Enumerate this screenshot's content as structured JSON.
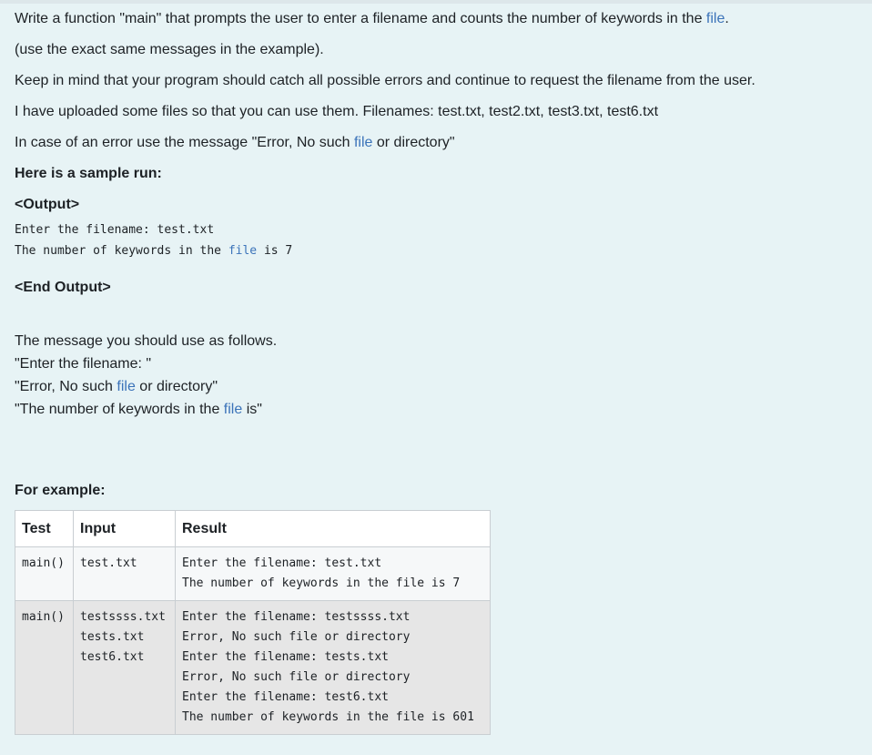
{
  "intro": {
    "line1_before": "Write a function \"main\" that prompts the user to enter a filename and counts the number of keywords in the ",
    "line1_kw": "file",
    "line1_after": ".",
    "line2": "(use the exact same messages in the example).",
    "line3": "Keep in mind that your program should catch all possible errors and continue to request the filename from the user.",
    "line4": "I have uploaded some files so that you can use them. Filenames: test.txt, test2.txt, test3.txt, test6.txt",
    "line5_before": "In case of an error use the message \"Error, No such ",
    "line5_kw": "file",
    "line5_after": " or directory\""
  },
  "sample": {
    "heading": "Here is a sample run:",
    "output_open": "<Output>",
    "out_line1": "Enter the filename: test.txt",
    "out_line2_before": "The number of keywords in the ",
    "out_line2_kw": "file",
    "out_line2_after": " is 7",
    "output_close": "<End Output>"
  },
  "messages": {
    "intro": "The message you should use as follows.",
    "m1": "\"Enter the filename: \"",
    "m2_before": "\"Error, No such ",
    "m2_kw": "file",
    "m2_after": " or directory\"",
    "m3_before": "\"The number of keywords in the ",
    "m3_kw": "file",
    "m3_after": " is\""
  },
  "examples": {
    "heading": "For example:",
    "columns": [
      "Test",
      "Input",
      "Result"
    ],
    "rows": [
      {
        "test": "main()",
        "input": "test.txt",
        "result": "Enter the filename: test.txt\nThe number of keywords in the file is 7"
      },
      {
        "test": "main()",
        "input": "testssss.txt\ntests.txt\ntest6.txt",
        "result": "Enter the filename: testssss.txt\nError, No such file or directory\nEnter the filename: tests.txt\nError, No such file or directory\nEnter the filename: test6.txt\nThe number of keywords in the file is 601"
      }
    ]
  },
  "colors": {
    "background": "#e7f3f5",
    "keyword_link": "#3b73b9",
    "table_header_bg": "#ffffff",
    "row1_bg": "#f6f8f9",
    "row2_bg": "#e6e6e6"
  }
}
